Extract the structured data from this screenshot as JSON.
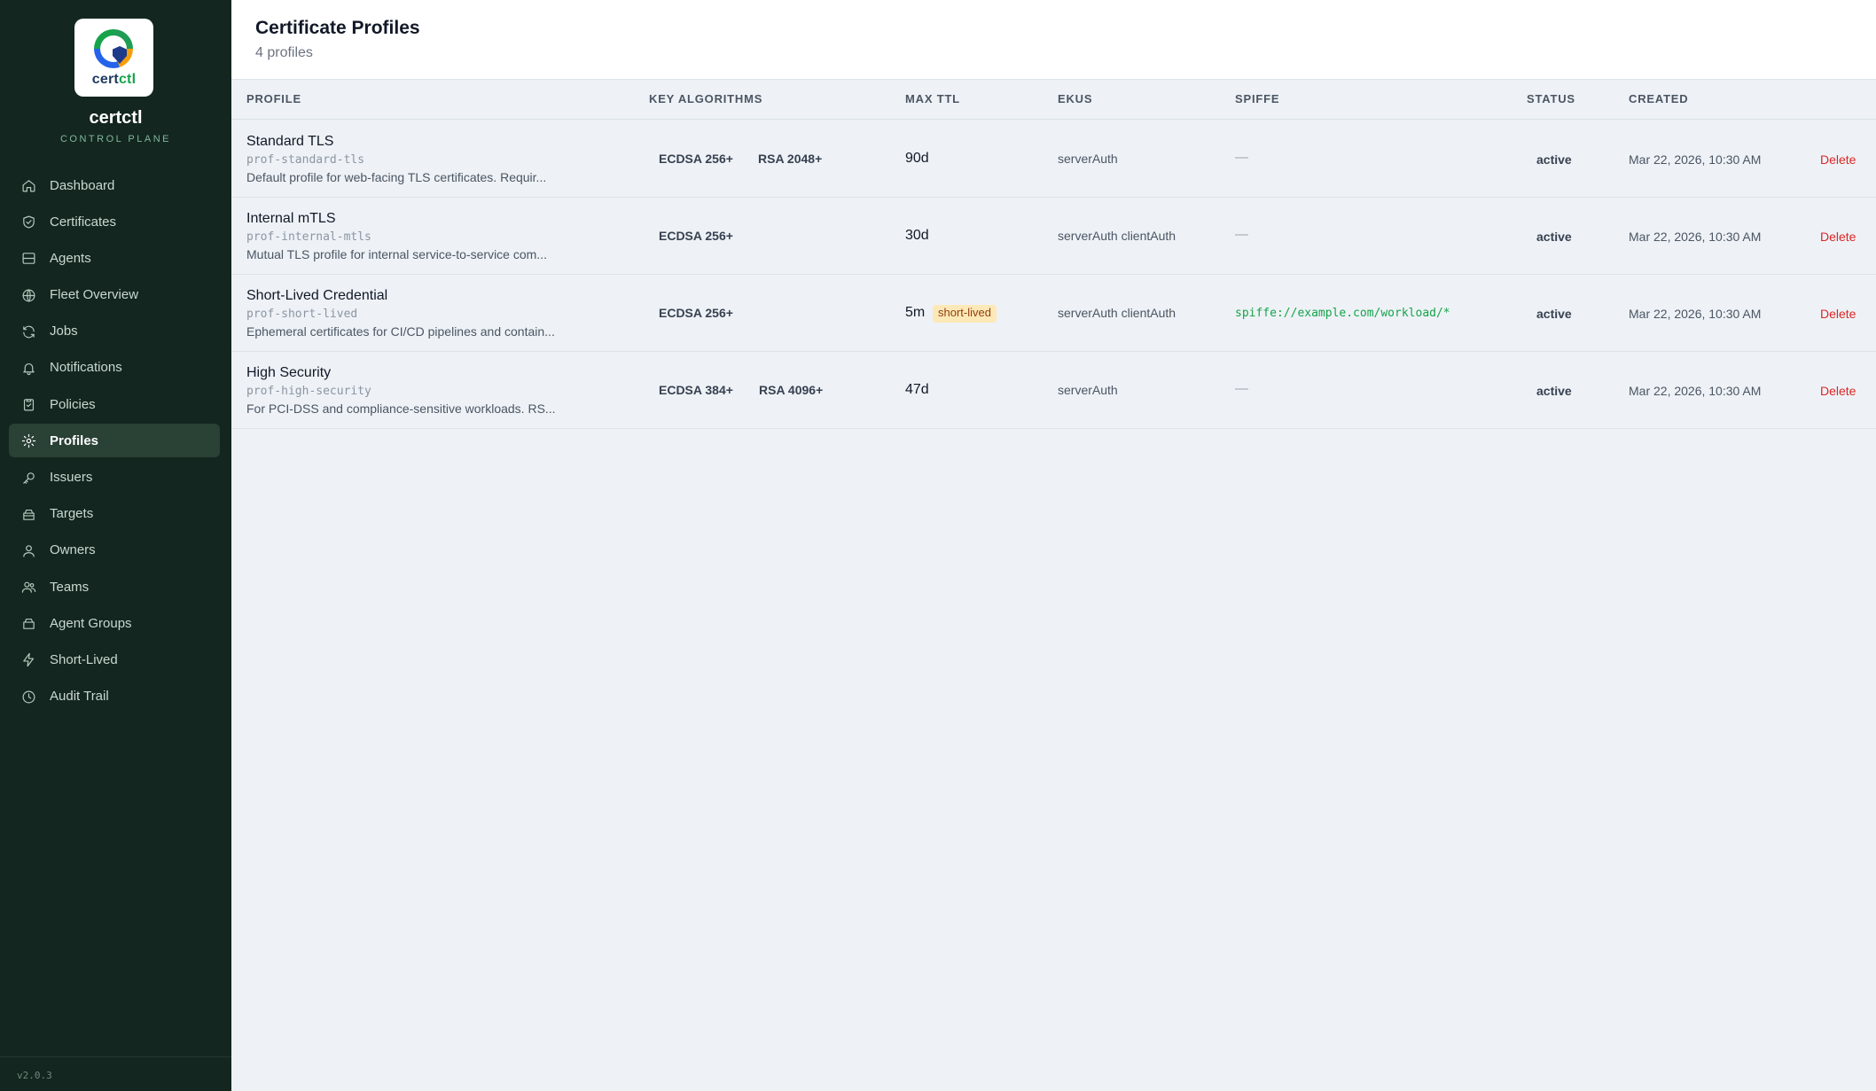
{
  "sidebar": {
    "logo_word_a": "cert",
    "logo_word_b": "ctl",
    "brand_name": "certctl",
    "brand_sub": "CONTROL PLANE",
    "version": "v2.0.3",
    "items": [
      {
        "label": "Dashboard",
        "icon": "home-icon"
      },
      {
        "label": "Certificates",
        "icon": "shield-check-icon"
      },
      {
        "label": "Agents",
        "icon": "server-icon"
      },
      {
        "label": "Fleet Overview",
        "icon": "globe-icon"
      },
      {
        "label": "Jobs",
        "icon": "refresh-icon"
      },
      {
        "label": "Notifications",
        "icon": "bell-icon"
      },
      {
        "label": "Policies",
        "icon": "clipboard-check-icon"
      },
      {
        "label": "Profiles",
        "icon": "gear-icon",
        "active": true
      },
      {
        "label": "Issuers",
        "icon": "key-icon"
      },
      {
        "label": "Targets",
        "icon": "box-icon"
      },
      {
        "label": "Owners",
        "icon": "user-icon"
      },
      {
        "label": "Teams",
        "icon": "users-icon"
      },
      {
        "label": "Agent Groups",
        "icon": "layers-icon"
      },
      {
        "label": "Short-Lived",
        "icon": "lightning-icon"
      },
      {
        "label": "Audit Trail",
        "icon": "clock-icon"
      }
    ]
  },
  "header": {
    "title": "Certificate Profiles",
    "count": "4 profiles"
  },
  "table": {
    "columns": {
      "profile": "PROFILE",
      "key_algorithms": "KEY ALGORITHMS",
      "max_ttl": "MAX TTL",
      "ekus": "EKUS",
      "spiffe": "SPIFFE",
      "status": "STATUS",
      "created": "CREATED"
    },
    "delete_label": "Delete",
    "rows": [
      {
        "name": "Standard TLS",
        "id": "prof-standard-tls",
        "description": "Default profile for web-facing TLS certificates. Requir...",
        "alg1": "ECDSA 256+",
        "alg2": "RSA 2048+",
        "ttl": "90d",
        "badge": "",
        "ekus": "serverAuth",
        "spiffe": "—",
        "status": "active",
        "created": "Mar 22, 2026, 10:30 AM"
      },
      {
        "name": "Internal mTLS",
        "id": "prof-internal-mtls",
        "description": "Mutual TLS profile for internal service-to-service com...",
        "alg1": "ECDSA 256+",
        "alg2": "",
        "ttl": "30d",
        "badge": "",
        "ekus": "serverAuth clientAuth",
        "spiffe": "—",
        "status": "active",
        "created": "Mar 22, 2026, 10:30 AM"
      },
      {
        "name": "Short-Lived Credential",
        "id": "prof-short-lived",
        "description": "Ephemeral certificates for CI/CD pipelines and contain...",
        "alg1": "ECDSA 256+",
        "alg2": "",
        "ttl": "5m",
        "badge": "short-lived",
        "ekus": "serverAuth clientAuth",
        "spiffe": "spiffe://example.com/workload/*",
        "status": "active",
        "created": "Mar 22, 2026, 10:30 AM"
      },
      {
        "name": "High Security",
        "id": "prof-high-security",
        "description": "For PCI-DSS and compliance-sensitive workloads. RS...",
        "alg1": "ECDSA 384+",
        "alg2": "RSA 4096+",
        "ttl": "47d",
        "badge": "",
        "ekus": "serverAuth",
        "spiffe": "—",
        "status": "active",
        "created": "Mar 22, 2026, 10:30 AM"
      }
    ]
  },
  "colors": {
    "sidebar_bg": "#13261f",
    "accent_green": "#16a34a",
    "delete_red": "#dc2626",
    "badge_bg": "#fde9b8"
  }
}
